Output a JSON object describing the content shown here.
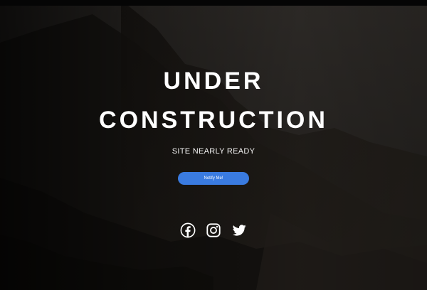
{
  "hero": {
    "title_line_1": "UNDER",
    "title_line_2": "CONSTRUCTION",
    "subtitle": "SITE NEARLY READY",
    "notify_button_label": "Notify Me!"
  },
  "socials": [
    {
      "icon": "facebook-icon"
    },
    {
      "icon": "instagram-icon"
    },
    {
      "icon": "twitter-icon"
    }
  ],
  "colors": {
    "button": "#3a7be0",
    "text": "#ffffff",
    "background": "#0b0b0b"
  }
}
